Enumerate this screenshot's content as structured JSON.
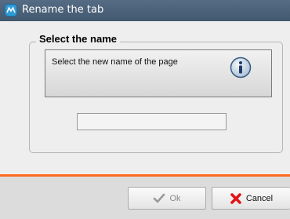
{
  "window": {
    "title": "Rename the tab"
  },
  "group": {
    "legend": "Select the name"
  },
  "info": {
    "message": "Select the new name of the page",
    "icon": "info-icon"
  },
  "name_field": {
    "value": ""
  },
  "buttons": {
    "ok": {
      "label": "Ok",
      "icon": "checkmark-icon",
      "enabled": false
    },
    "cancel": {
      "label": "Cancel",
      "icon": "red-x-icon",
      "enabled": true
    }
  },
  "colors": {
    "titlebar": "#4d627a",
    "accent_separator": "#ff6a1f",
    "cancel_icon": "#e0161b"
  }
}
